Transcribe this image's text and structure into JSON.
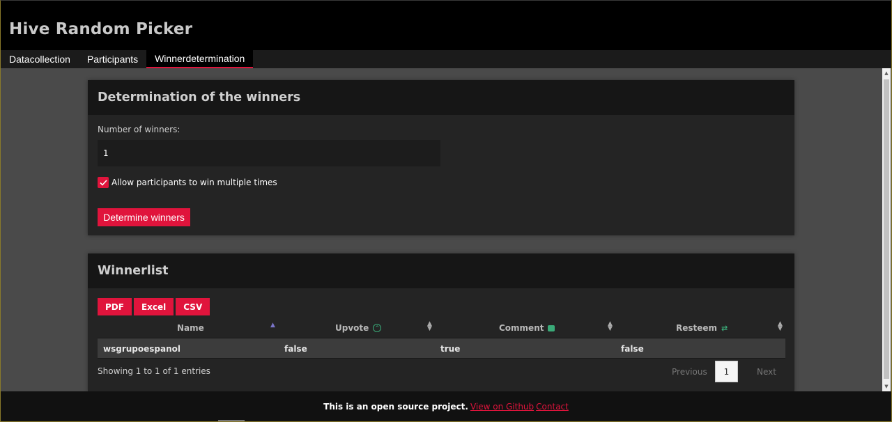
{
  "app": {
    "title": "Hive Random Picker"
  },
  "nav": {
    "tabs": [
      {
        "label": "Datacollection"
      },
      {
        "label": "Participants"
      },
      {
        "label": "Winnerdetermination"
      }
    ],
    "active": "Winnerdetermination"
  },
  "determination": {
    "title": "Determination of the winners",
    "num_label": "Number of winners:",
    "num_value": "1",
    "allow_multiple_label": "Allow participants to win multiple times",
    "allow_multiple_checked": true,
    "button_label": "Determine winners"
  },
  "winnerlist": {
    "title": "Winnerlist",
    "exports": [
      "PDF",
      "Excel",
      "CSV"
    ],
    "columns": [
      "Name",
      "Upvote",
      "Comment",
      "Resteem"
    ],
    "rows": [
      {
        "name": "wsgrupoespanol",
        "upvote": "false",
        "comment": "true",
        "resteem": "false"
      }
    ],
    "info": "Showing 1 to 1 of 1 entries",
    "pagination": {
      "previous": "Previous",
      "page": "1",
      "next": "Next"
    }
  },
  "footer": {
    "text": "This is an open source project.",
    "github_link": "View on Github",
    "contact_link": "Contact"
  },
  "colors": {
    "accent": "#e0143c",
    "icon_green": "#3aaa78",
    "header_bg": "#000000",
    "card_bg": "#242424"
  },
  "icons": [
    "check-icon",
    "sort-icon",
    "upvote-icon",
    "comment-icon",
    "resteem-icon"
  ]
}
